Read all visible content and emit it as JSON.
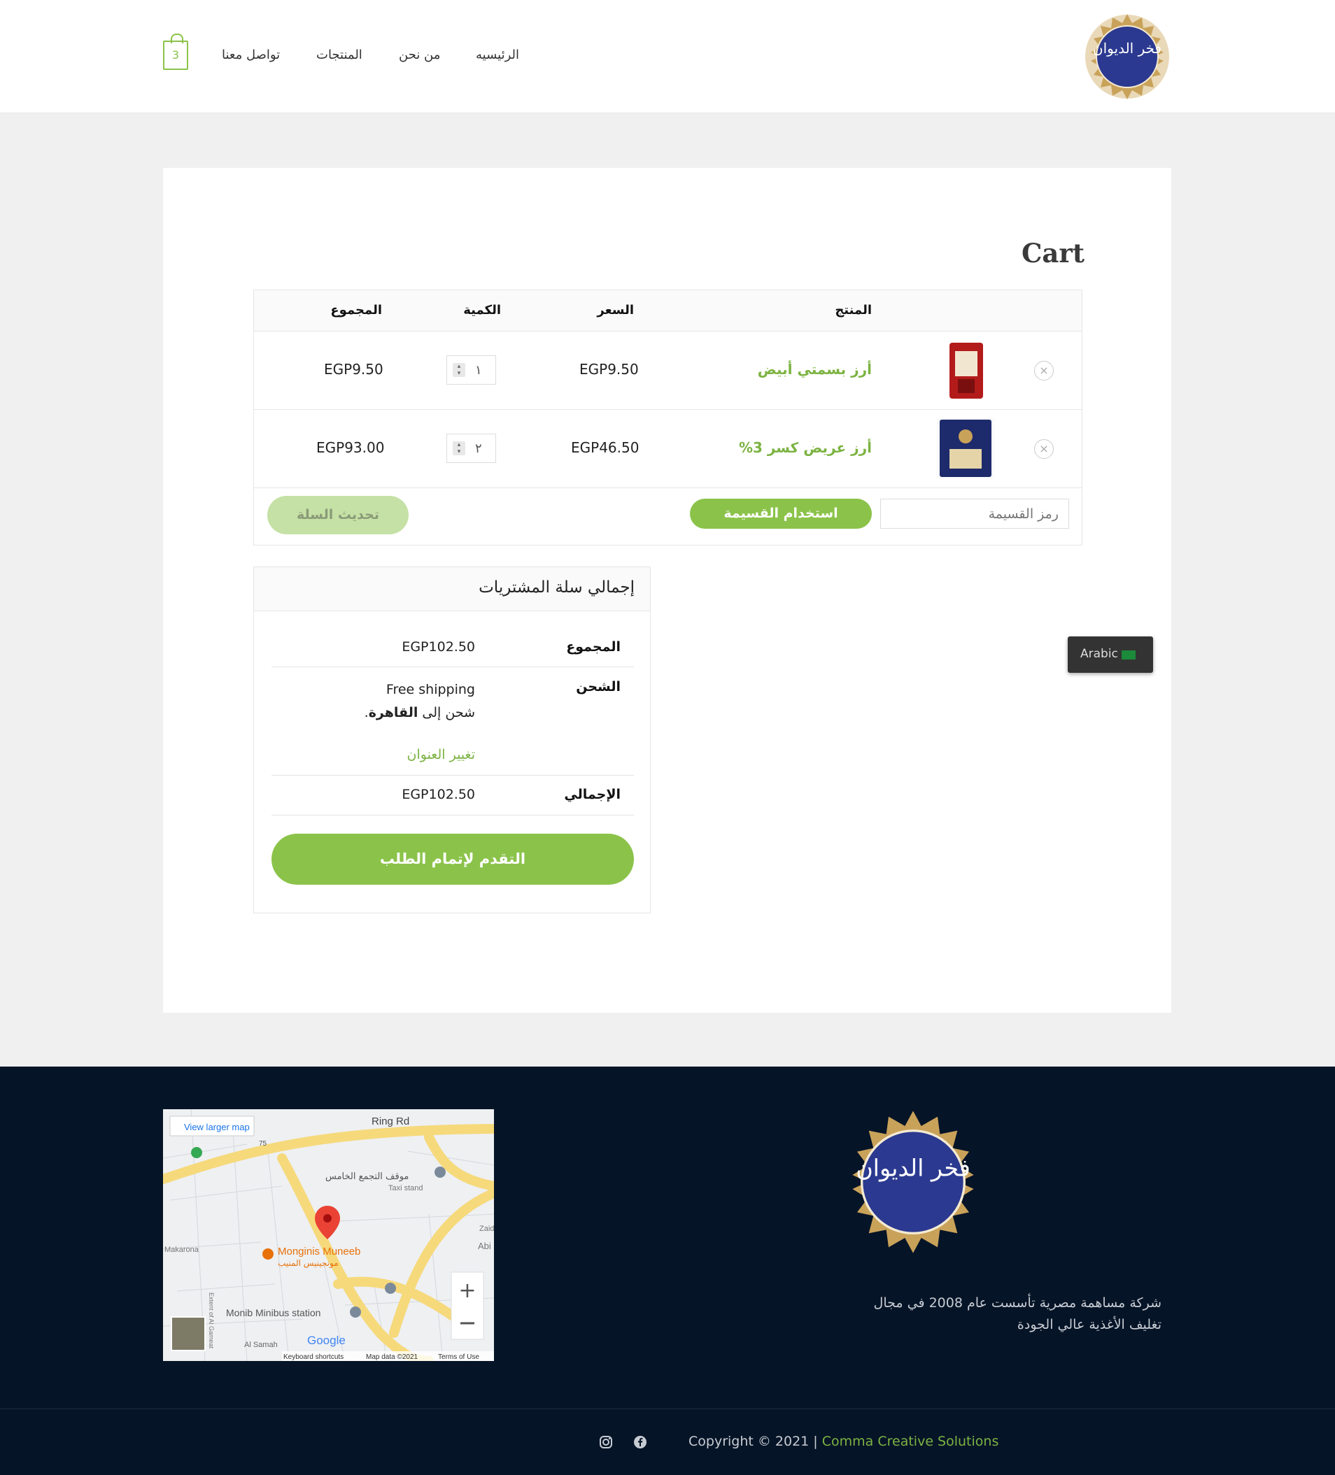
{
  "header": {
    "cart_count": "3",
    "nav": [
      "الرئيسيه",
      "من نحن",
      "المنتجات",
      "تواصل معنا"
    ],
    "logo_text": "فخر الديوان"
  },
  "page": {
    "title": "Cart"
  },
  "cart_table": {
    "headers": {
      "product": "المنتج",
      "price": "السعر",
      "quantity": "الكمية",
      "subtotal": "المجموع"
    },
    "items": [
      {
        "name": "أرز بسمتي أبيض",
        "price": "EGP9.50",
        "qty": "١",
        "subtotal": "EGP9.50"
      },
      {
        "name": "أرز عريض كسر 3%",
        "price": "EGP46.50",
        "qty": "٢",
        "subtotal": "EGP93.00"
      }
    ],
    "remove_symbol": "×",
    "coupon_placeholder": "رمز القسيمة",
    "apply_coupon": "استخدام القسيمة",
    "update_cart": "تحديث السلة"
  },
  "totals": {
    "title": "إجمالي سلة المشتريات",
    "subtotal_label": "المجموع",
    "subtotal_value": "EGP102.50",
    "shipping_label": "الشحن",
    "shipping_method": "Free shipping",
    "shipping_to_prefix": "شحن إلى",
    "shipping_city": "القاهرة",
    "change_address": "تغيير العنوان",
    "total_label": "الإجمالي",
    "total_value": "EGP102.50",
    "checkout": "التقدم لإتمام الطلب"
  },
  "language_switcher": {
    "label": "Arabic"
  },
  "footer": {
    "map": {
      "view_larger": "View larger map",
      "labels": {
        "ring_rd": "Ring Rd",
        "taxi_ar": "موقف التجمع الخامس",
        "taxi_en": "Taxi stand",
        "monginis": "Monginis Muneeb",
        "monginis_ar": "مونجينيس المنيب",
        "makarona": "Makarona",
        "minibus": "Monib Minibus station",
        "al_samah": "Al Samah",
        "zaid": "Zaid",
        "abi": "Abi",
        "extent": "Extent of Al Gameat",
        "route_75": "75"
      },
      "google": "Google",
      "keyboard": "Keyboard shortcuts",
      "map_data": "Map data ©2021",
      "terms": "Terms of Use"
    },
    "description": "شركة مساهمة مصرية تأسست عام 2008 في مجال تغليف الأغذية عالي الجودة",
    "copyright_prefix": "Copyright © 2021 | ",
    "copyright_link": "Comma Creative Solutions"
  },
  "colors": {
    "accent": "#8bc34a",
    "footer_bg": "#061427",
    "logo_blue": "#2b3990",
    "logo_gold": "#c9a25a"
  }
}
